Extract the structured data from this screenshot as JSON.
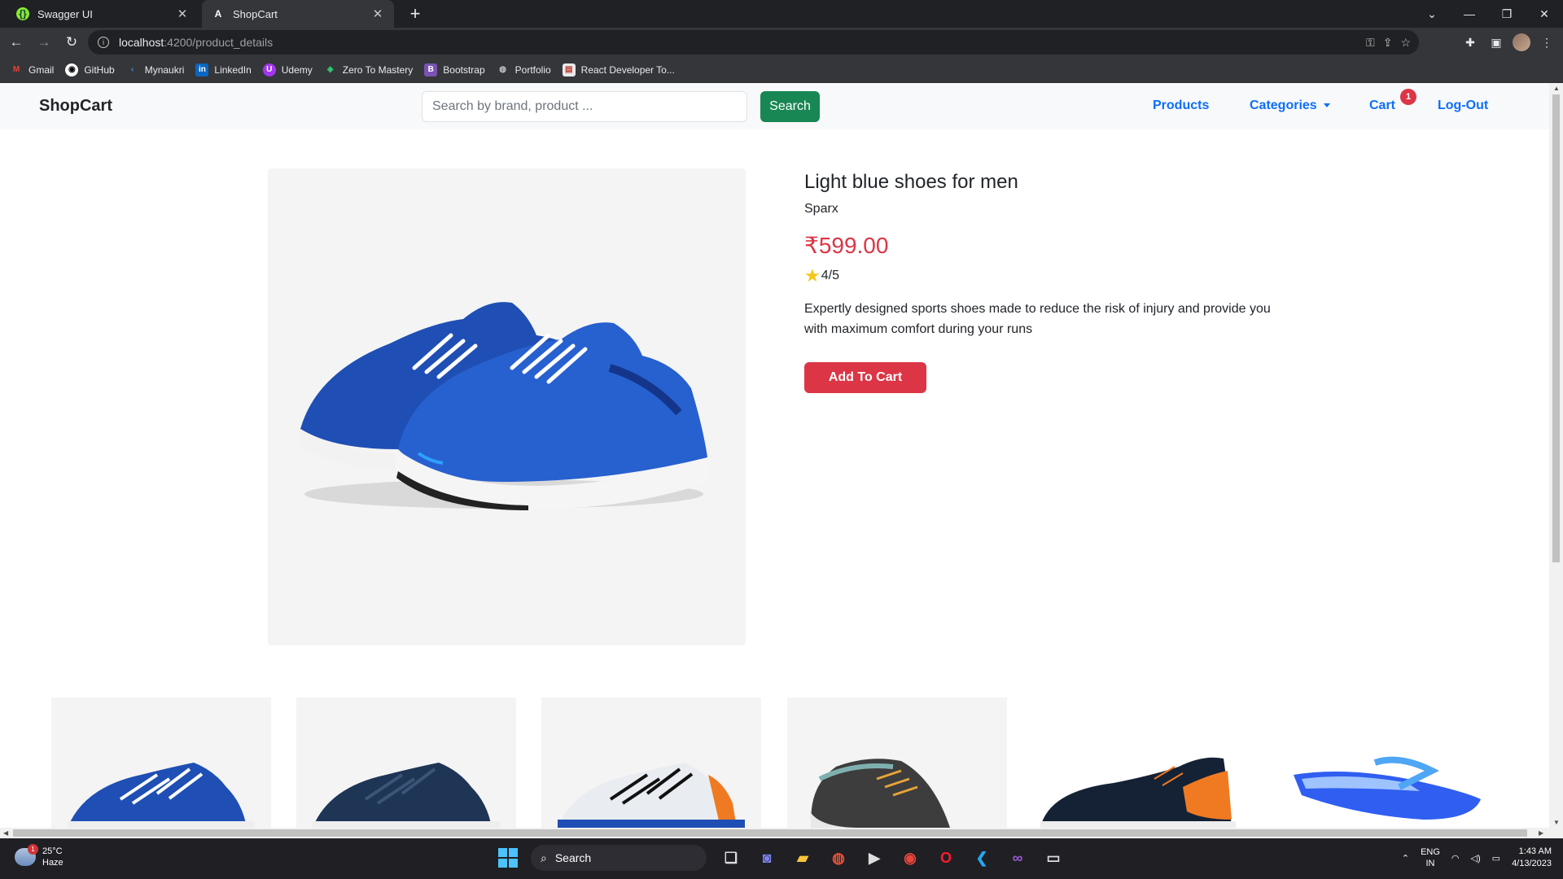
{
  "browser": {
    "tabs": [
      {
        "title": "Swagger UI",
        "favicon": "swagger-icon"
      },
      {
        "title": "ShopCart",
        "favicon": "angular-icon"
      }
    ],
    "url": {
      "host": "localhost",
      "path": ":4200/product_details"
    },
    "bookmarks": [
      {
        "label": "Gmail",
        "icon": "gmail-icon"
      },
      {
        "label": "GitHub",
        "icon": "github-icon"
      },
      {
        "label": "Mynaukri",
        "icon": "naukri-icon"
      },
      {
        "label": "LinkedIn",
        "icon": "linkedin-icon"
      },
      {
        "label": "Udemy",
        "icon": "udemy-icon"
      },
      {
        "label": "Zero To Mastery",
        "icon": "ztm-icon"
      },
      {
        "label": "Bootstrap",
        "icon": "bootstrap-icon"
      },
      {
        "label": "Portfolio",
        "icon": "globe-icon"
      },
      {
        "label": "React Developer To...",
        "icon": "react-icon"
      }
    ]
  },
  "navbar": {
    "brand": "ShopCart",
    "search_placeholder": "Search by brand, product ...",
    "search_button": "Search",
    "links": {
      "products": "Products",
      "categories": "Categories",
      "cart": "Cart",
      "logout": "Log-Out"
    },
    "cart_count": "1"
  },
  "product": {
    "title": "Light blue shoes for men",
    "brand": "Sparx",
    "price": "₹599.00",
    "rating": "4/5",
    "description": "Expertly designed sports shoes made to reduce the risk of injury and provide you with maximum comfort during your runs",
    "add_to_cart": "Add To Cart"
  },
  "related": [
    {
      "name": "blue-running-shoes"
    },
    {
      "name": "navy-running-shoes"
    },
    {
      "name": "white-running-shoes"
    },
    {
      "name": "grey-trail-shoes"
    },
    {
      "name": "black-orange-sneakers"
    },
    {
      "name": "blue-flip-flops"
    }
  ],
  "taskbar": {
    "weather_temp": "25°C",
    "weather_desc": "Haze",
    "weather_badge": "1",
    "search": "Search",
    "lang_line1": "ENG",
    "lang_line2": "IN",
    "time": "1:43 AM",
    "date": "4/13/2023"
  },
  "colors": {
    "primary": "#0d6efd",
    "success": "#198754",
    "danger": "#dc3545",
    "shoe_blue": "#1f4fb4",
    "shoe_navy": "#1e3556",
    "shoe_orange": "#f07a22"
  }
}
